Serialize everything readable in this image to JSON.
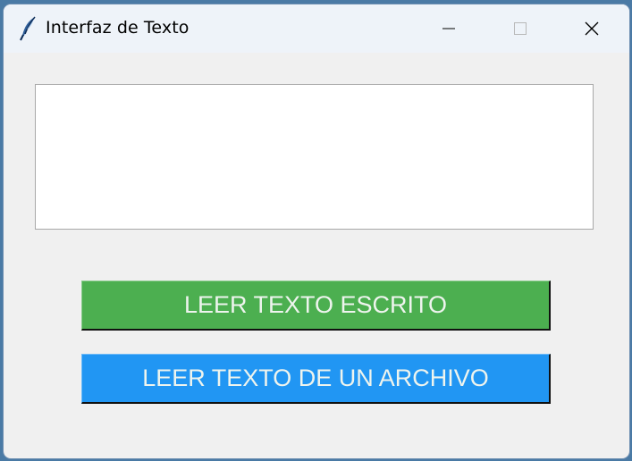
{
  "window": {
    "title": "Interfaz de Texto",
    "icon": "feather-icon",
    "controls": [
      "minimize-icon",
      "maximize-icon",
      "close-icon"
    ]
  },
  "text_area": {
    "value": ""
  },
  "buttons": {
    "read_written": {
      "label": "LEER TEXTO ESCRITO",
      "color": "#4caf50"
    },
    "read_file": {
      "label": "LEER TEXTO DE UN ARCHIVO",
      "color": "#2196f3"
    }
  }
}
